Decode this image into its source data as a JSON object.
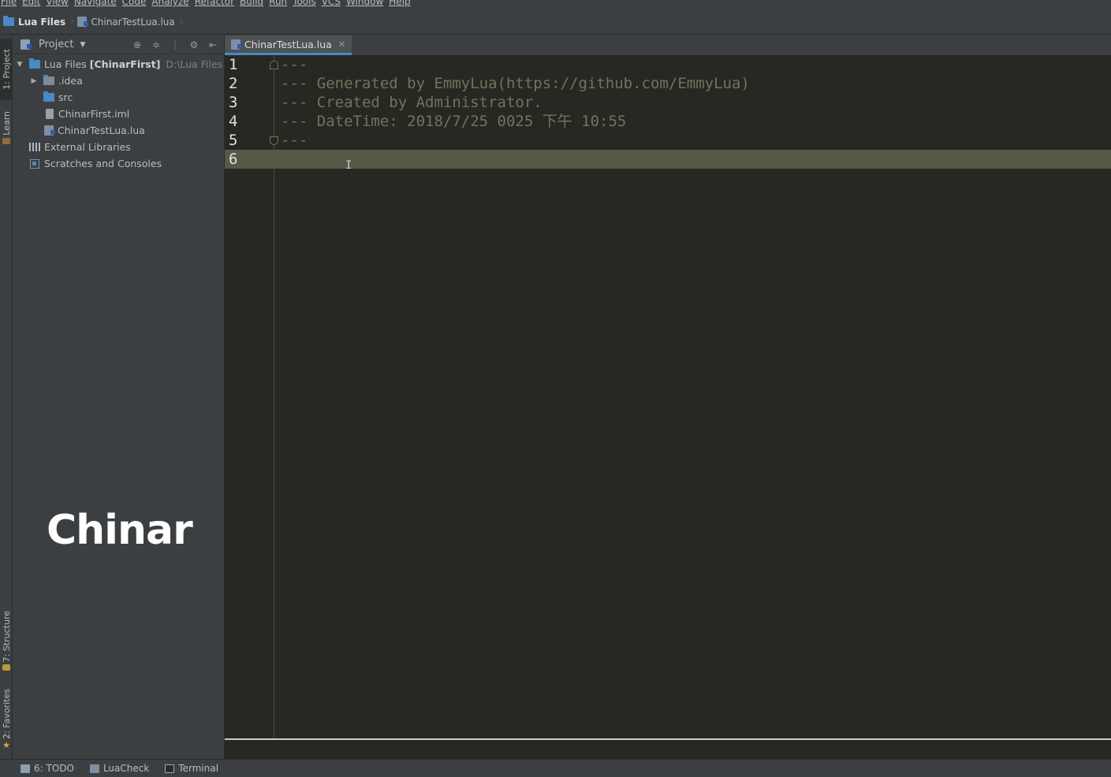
{
  "menu": [
    "File",
    "Edit",
    "View",
    "Navigate",
    "Code",
    "Analyze",
    "Refactor",
    "Build",
    "Run",
    "Tools",
    "VCS",
    "Window",
    "Help"
  ],
  "breadcrumb": {
    "project": "Lua Files",
    "file": "ChinarTestLua.lua"
  },
  "left_tabs": {
    "project": "1: Project",
    "learn": "Learn",
    "structure": "7: Structure",
    "favorites": "2: Favorites"
  },
  "project_panel": {
    "title": "Project",
    "root": {
      "name": "Lua Files",
      "module": "[ChinarFirst]",
      "path": "D:\\Lua Files"
    },
    "items": [
      ".idea",
      "src",
      "ChinarFirst.iml",
      "ChinarTestLua.lua"
    ],
    "external_libraries": "External Libraries",
    "scratches": "Scratches and Consoles"
  },
  "watermark": "Chinar",
  "editor": {
    "tab": "ChinarTestLua.lua",
    "line_numbers": [
      "1",
      "2",
      "3",
      "4",
      "5",
      "6"
    ],
    "lines": [
      "---",
      "--- Generated by EmmyLua(https://github.com/EmmyLua)",
      "--- Created by Administrator.",
      "--- DateTime: 2018/7/25 0025 下午 10:55",
      "---",
      ""
    ],
    "cursor_glyph": "I"
  },
  "status_bar": {
    "todo": "6: TODO",
    "luacheck": "LuaCheck",
    "terminal": "Terminal"
  },
  "colors": {
    "accent": "#4a88c7",
    "editor_bg": "#272822",
    "comment": "#75715e",
    "current_line": "#575847"
  }
}
